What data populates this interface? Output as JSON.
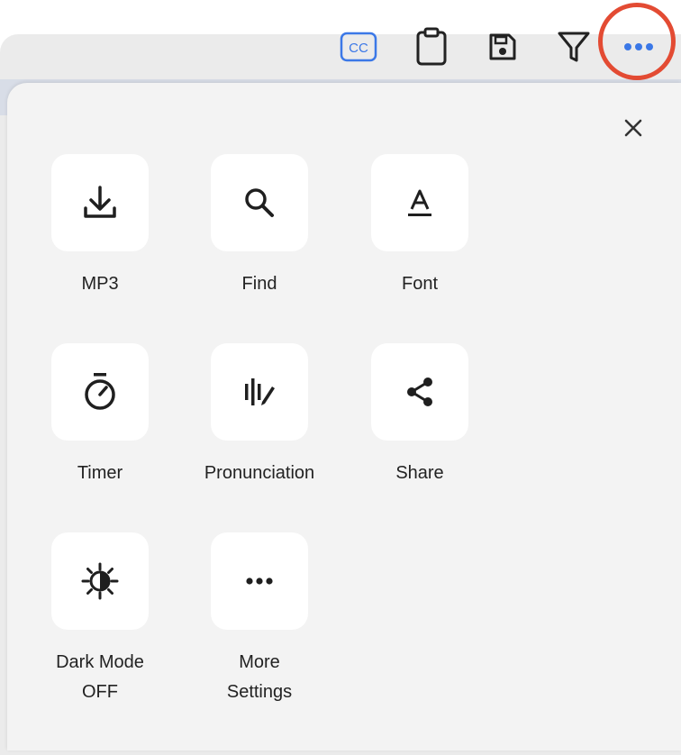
{
  "toolbar": {
    "cc_label": "CC",
    "buttons": [
      "cc-icon",
      "clipboard-icon",
      "save-icon",
      "filter-icon",
      "more-icon"
    ],
    "accent": "#3b78e7",
    "highlight_color": "#e34b33"
  },
  "menu": {
    "close_icon": "close-icon",
    "items": [
      {
        "label": "MP3",
        "icon": "download-icon"
      },
      {
        "label": "Find",
        "icon": "search-icon"
      },
      {
        "label": "Font",
        "icon": "font-icon"
      },
      {
        "label": "Timer",
        "icon": "timer-icon"
      },
      {
        "label": "Pronunciation",
        "icon": "pronunciation-icon"
      },
      {
        "label": "Share",
        "icon": "share-icon"
      },
      {
        "label": "Dark Mode OFF",
        "label_line1": "Dark Mode",
        "label_line2": "OFF",
        "icon": "contrast-icon"
      },
      {
        "label": "More Settings",
        "label_line1": "More",
        "label_line2": "Settings",
        "icon": "more-icon"
      }
    ]
  }
}
